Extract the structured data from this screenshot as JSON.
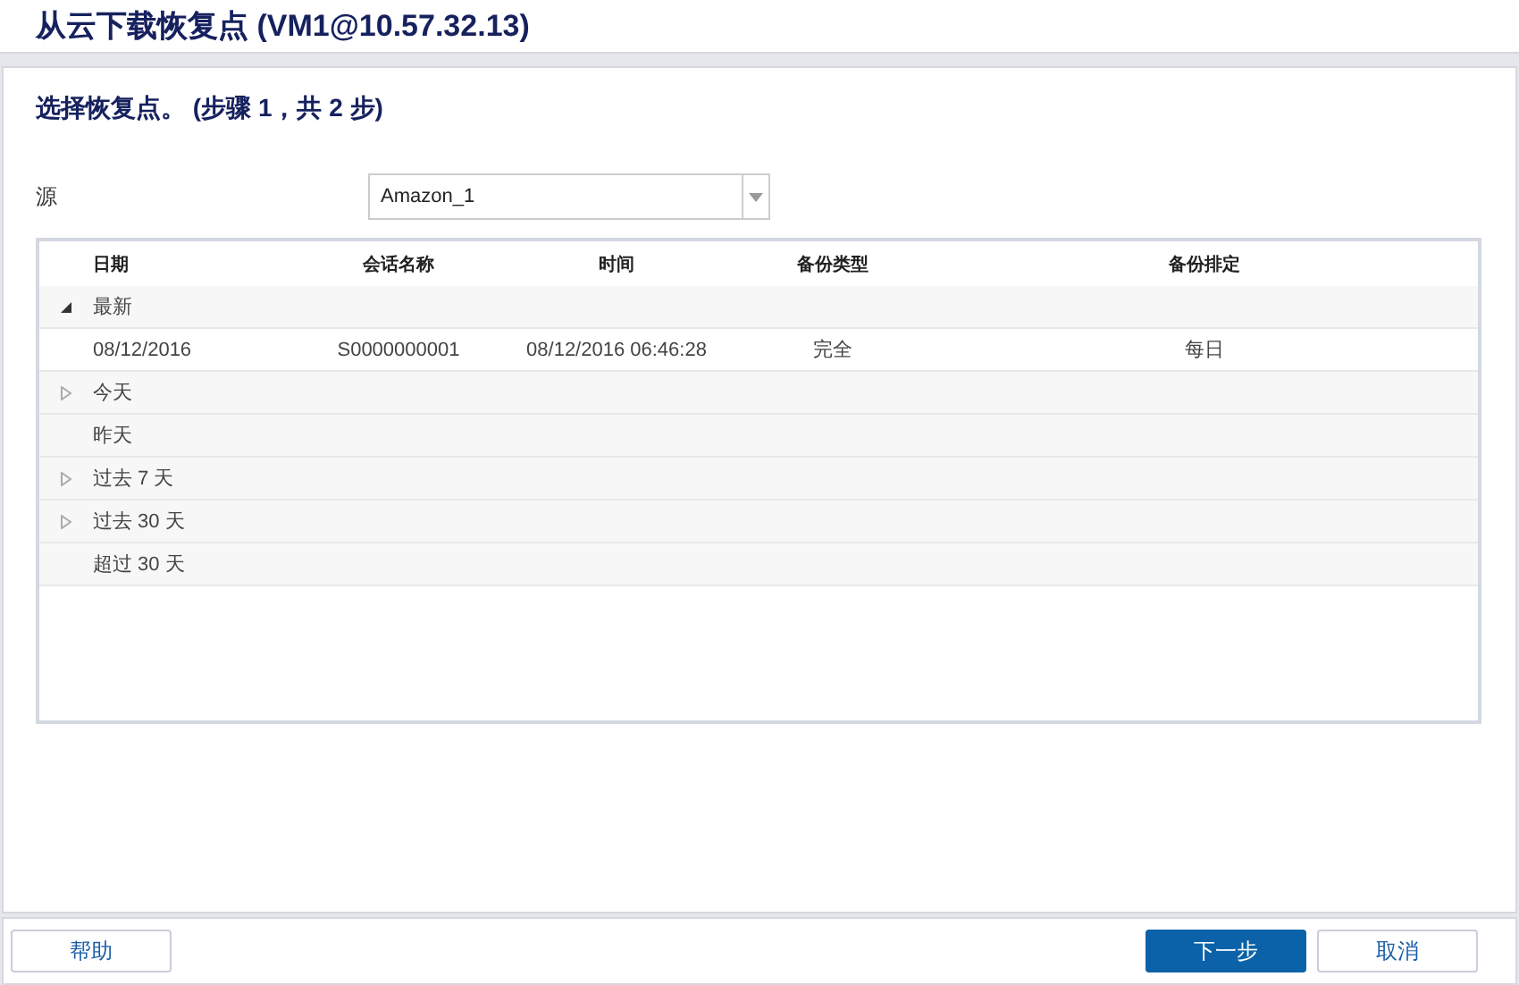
{
  "window": {
    "title": "从云下载恢复点 (VM1@10.57.32.13)"
  },
  "step_title": "选择恢复点。 (步骤 1，共 2 步)",
  "source": {
    "label": "源",
    "value": "Amazon_1"
  },
  "table": {
    "columns": [
      "日期",
      "会话名称",
      "时间",
      "备份类型",
      "备份排定"
    ],
    "rows": [
      {
        "kind": "group",
        "label": "最新",
        "expanded": true
      },
      {
        "kind": "record",
        "cells": [
          "08/12/2016",
          "S0000000001",
          "08/12/2016 06:46:28",
          "完全",
          "每日"
        ]
      },
      {
        "kind": "group",
        "label": "今天",
        "expanded": false
      },
      {
        "kind": "empty-group",
        "label": "昨天"
      },
      {
        "kind": "group",
        "label": "过去 7 天",
        "expanded": false
      },
      {
        "kind": "group",
        "label": "过去 30 天",
        "expanded": false
      },
      {
        "kind": "empty-group",
        "label": "超过 30 天"
      }
    ]
  },
  "buttons": {
    "help": "帮助",
    "next": "下一步",
    "cancel": "取消"
  }
}
